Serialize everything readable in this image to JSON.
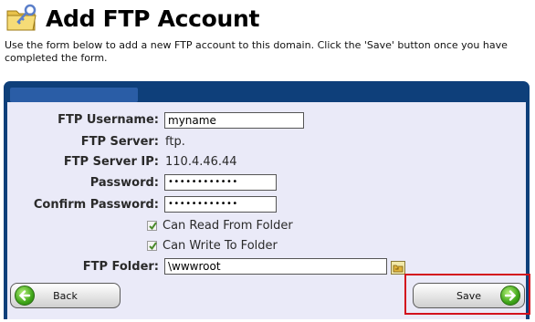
{
  "header": {
    "title": "Add FTP Account",
    "icon": "folder-key-icon"
  },
  "intro_text": "Use the form below to add a new FTP account to this domain. Click the 'Save' button once you have completed the form.",
  "form": {
    "username": {
      "label": "FTP Username:",
      "value": "myname"
    },
    "server": {
      "label": "FTP Server:",
      "value": "ftp."
    },
    "server_ip": {
      "label": "FTP Server IP:",
      "value": "110.4.46.44"
    },
    "password": {
      "label": "Password:",
      "value": "••••••••••••"
    },
    "confirm_password": {
      "label": "Confirm Password:",
      "value": "••••••••••••"
    },
    "can_read": {
      "label": "Can Read From Folder",
      "checked": true
    },
    "can_write": {
      "label": "Can Write To Folder",
      "checked": true
    },
    "folder": {
      "label": "FTP Folder:",
      "value": "\\wwwroot"
    }
  },
  "buttons": {
    "back": "Back",
    "save": "Save"
  },
  "colors": {
    "panel": "#0e3f7a",
    "panel_bg": "#eaeaf8",
    "highlight": "#d3111d",
    "arrow": "#3fa519"
  }
}
